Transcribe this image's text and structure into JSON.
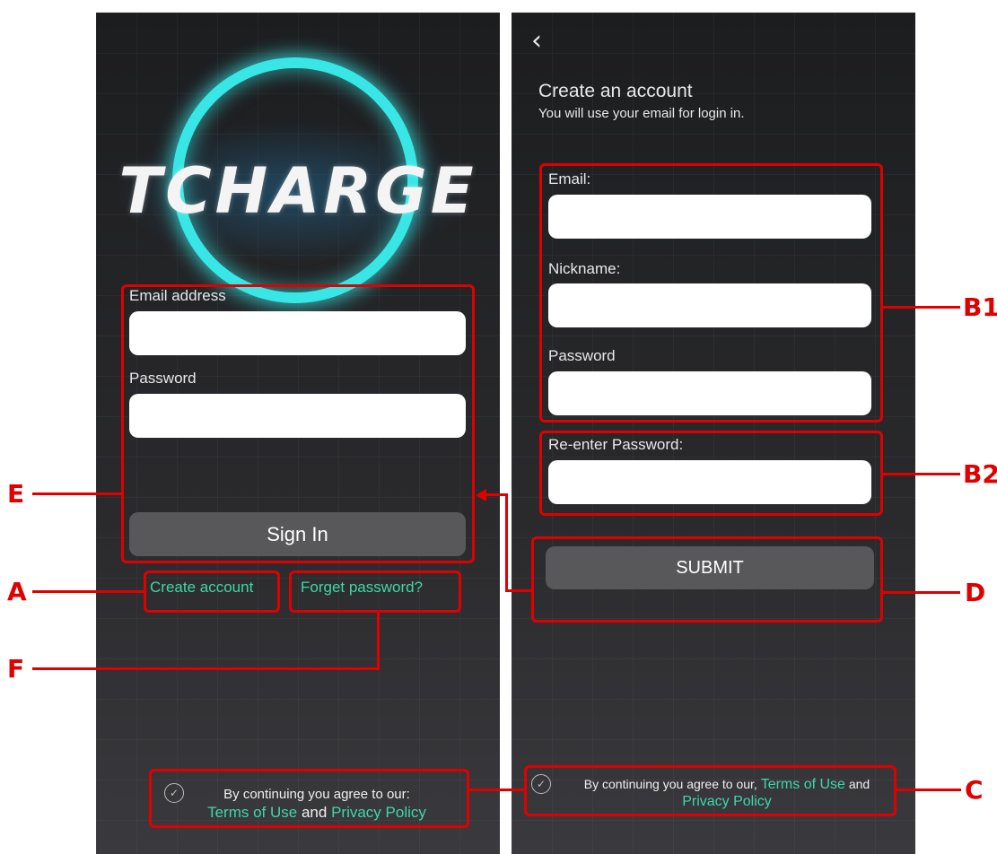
{
  "login": {
    "logo_text": "TCHARGE",
    "email_label": "Email address",
    "email_value": "",
    "password_label": "Password",
    "password_value": "",
    "sign_in_label": "Sign In",
    "create_account_label": "Create account",
    "forget_password_label": "Forget password?",
    "terms_prefix": "By continuing you agree to our:",
    "terms_of_use": "Terms of Use",
    "and": "and",
    "privacy_policy": "Privacy Policy",
    "checkbox_icon": "check-icon"
  },
  "register": {
    "back_icon": "chevron-left-icon",
    "title": "Create an account",
    "subtitle": "You will use your email for login in.",
    "email_label": "Email:",
    "email_value": "",
    "nickname_label": "Nickname:",
    "nickname_value": "",
    "password_label": "Password",
    "password_value": "",
    "reenter_label": "Re-enter Password:",
    "reenter_value": "",
    "submit_label": "SUBMIT",
    "terms_prefix": "By continuing you agree to our,",
    "terms_of_use": "Terms of Use",
    "and": "and",
    "privacy_policy": "Privacy Policy"
  },
  "annotations": {
    "A": "A",
    "B1": "B1",
    "B2": "B2",
    "C": "C",
    "D": "D",
    "E": "E",
    "F": "F",
    "color": "#e00000"
  },
  "colors": {
    "accent_teal": "#3fd6a6",
    "logo_ring": "#39e6e6",
    "button": "#58585a"
  }
}
